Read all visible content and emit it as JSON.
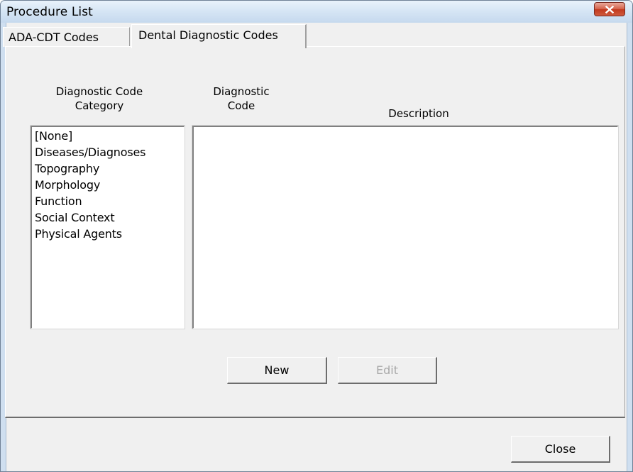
{
  "window": {
    "title": "Procedure List"
  },
  "tabs": [
    {
      "label": "ADA-CDT Codes",
      "active": false
    },
    {
      "label": "Dental Diagnostic Codes",
      "active": true
    }
  ],
  "category_panel": {
    "header": "Diagnostic Code\nCategory",
    "items": [
      "[None]",
      "Diseases/Diagnoses",
      "Topography",
      "Morphology",
      "Function",
      "Social Context",
      "Physical Agents"
    ]
  },
  "codes_table": {
    "columns": [
      {
        "label": "Diagnostic\nCode"
      },
      {
        "label": "Description"
      }
    ],
    "rows": []
  },
  "buttons": {
    "new": {
      "label": "New",
      "enabled": true
    },
    "edit": {
      "label": "Edit",
      "enabled": false
    },
    "close": {
      "label": "Close",
      "enabled": true
    }
  },
  "icons": {
    "window_close": "close-icon"
  }
}
